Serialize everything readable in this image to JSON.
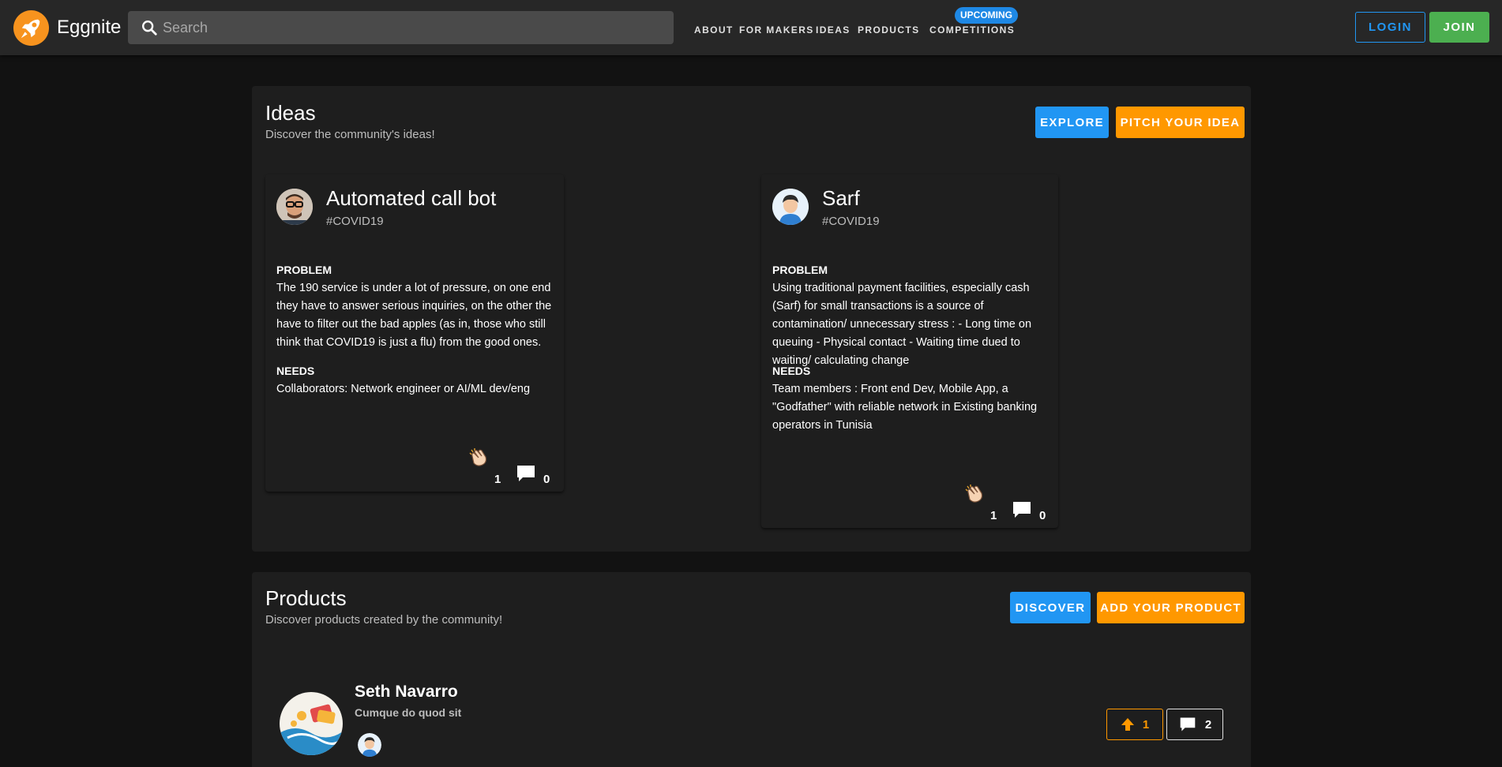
{
  "header": {
    "brand": "Eggnite",
    "search_placeholder": "Search",
    "nav": [
      "ABOUT",
      "FOR MAKERS",
      "IDEAS",
      "PRODUCTS",
      "COMPETITIONS"
    ],
    "badge": "UPCOMING",
    "login": "LOGIN",
    "join": "JOIN"
  },
  "ideas_section": {
    "title": "Ideas",
    "subtitle": "Discover the community's ideas!",
    "explore": "EXPLORE",
    "pitch": "PITCH YOUR IDEA",
    "cards": [
      {
        "title": "Automated call bot",
        "tag": "#COVID19",
        "problem_label": "PROBLEM",
        "problem": "The 190 service is under a lot of pressure, on one end they have to answer serious inquiries, on the other the have to filter out the bad apples (as in, those who still think that COVID19 is just a flu) from the good ones.",
        "needs_label": "NEEDS",
        "needs": "Collaborators: Network engineer or AI/ML dev/eng",
        "claps": "1",
        "comments": "0"
      },
      {
        "title": "Sarf",
        "tag": "#COVID19",
        "problem_label": "PROBLEM",
        "problem": "Using traditional payment facilities, especially cash (Sarf) for small transactions is a source of contamination/ unnecessary stress : - Long time on queuing - Physical contact - Waiting time dued to waiting/ calculating change",
        "needs_label": "NEEDS",
        "needs": "Team members : Front end Dev, Mobile App, a \"Godfather\" with reliable network in Existing banking operators in Tunisia",
        "claps": "1",
        "comments": "0"
      }
    ]
  },
  "products_section": {
    "title": "Products",
    "subtitle": "Discover products created by the community!",
    "discover": "DISCOVER",
    "add": "ADD YOUR PRODUCT",
    "items": [
      {
        "name": "Seth Navarro",
        "description": "Cumque do quod sit",
        "upvotes": "1",
        "comments": "2"
      }
    ]
  },
  "colors": {
    "accent_blue": "#2196f3",
    "accent_orange": "#ff9800",
    "join_green": "#4caf50",
    "badge_blue": "#1e88e5"
  },
  "icons": [
    "rocket-logo-icon",
    "search-icon",
    "clap-icon",
    "comment-icon",
    "upvote-arrow-icon"
  ]
}
